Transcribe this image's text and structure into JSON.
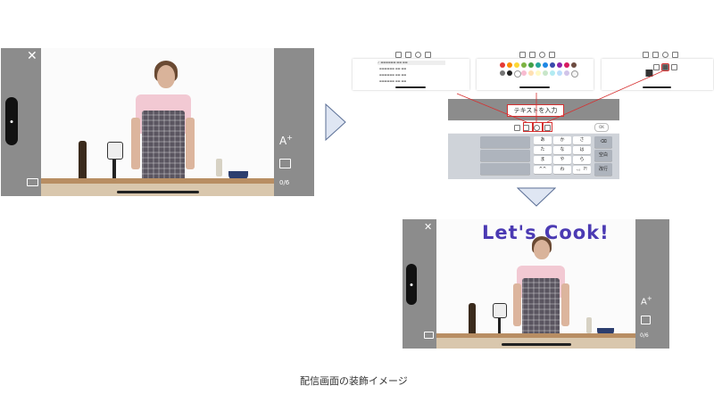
{
  "left_phone": {
    "close_icon": "close-icon",
    "text_add_label": "A",
    "text_add_superscript": "+",
    "counter": "0/6"
  },
  "editor": {
    "input_label": "テキストを入力",
    "done_label": "OK",
    "kana_rows": [
      [
        "あ",
        "か",
        "さ"
      ],
      [
        "た",
        "な",
        "は"
      ],
      [
        "ま",
        "や",
        "ら"
      ],
      [
        "^^",
        "わ",
        "、。?!"
      ]
    ],
    "side_keys": [
      "⌫",
      "空白",
      "改行"
    ],
    "palette": [
      "#e53935",
      "#fb8c00",
      "#fdd835",
      "#7cb342",
      "#43a047",
      "#26a69a",
      "#1e88e5",
      "#3949ab",
      "#8e24aa",
      "#d81b60",
      "#6d4c41",
      "#757575",
      "#212121",
      "#ffffff",
      "#f8bbd0",
      "#ffe0b2",
      "#fff9c4",
      "#c8e6c9",
      "#b2ebf2",
      "#bbdefb",
      "#d1c4e9",
      "#f5f5f5"
    ],
    "accent_red": "#d63030"
  },
  "right_phone": {
    "overlay_text": "Let's Cook!",
    "overlay_color": "#4b3ab3",
    "text_add_label": "A",
    "text_add_superscript": "+",
    "counter": "0/6"
  },
  "caption": "配信画面の装飾イメージ"
}
